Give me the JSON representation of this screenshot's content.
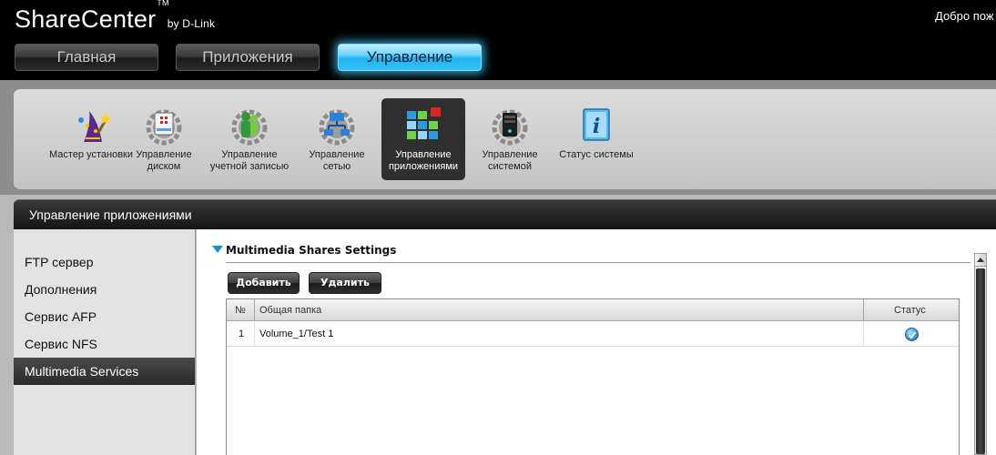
{
  "header": {
    "brand": "ShareCenter",
    "brand_tm": "TM",
    "brand_by": "by D-Link",
    "welcome": "Добро пож",
    "nav": [
      {
        "label": "Главная",
        "active": false
      },
      {
        "label": "Приложения",
        "active": false
      },
      {
        "label": "Управление",
        "active": true
      }
    ]
  },
  "toolbar": {
    "items": [
      {
        "label": "Мастер установки",
        "icon": "wizard-icon",
        "active": false
      },
      {
        "label": "Управление диском",
        "icon": "disk-icon",
        "active": false
      },
      {
        "label": "Управление учетной записью",
        "icon": "account-icon",
        "active": false
      },
      {
        "label": "Управление сетью",
        "icon": "network-icon",
        "active": false
      },
      {
        "label": "Управление приложениями",
        "icon": "applications-icon",
        "active": true
      },
      {
        "label": "Управление системой",
        "icon": "system-icon",
        "active": false
      },
      {
        "label": "Статус системы",
        "icon": "info-icon",
        "active": false
      }
    ]
  },
  "section": {
    "title": "Управление приложениями"
  },
  "sidebar": {
    "items": [
      {
        "label": "FTP сервер",
        "active": false
      },
      {
        "label": "Дополнения",
        "active": false
      },
      {
        "label": "Сервис AFP",
        "active": false
      },
      {
        "label": "Сервис NFS",
        "active": false
      },
      {
        "label": "Multimedia Services",
        "active": true
      }
    ]
  },
  "main": {
    "title": "Multimedia Shares Settings",
    "add_label": "Добавить",
    "delete_label": "Удалить",
    "table": {
      "columns": [
        "№",
        "Общая папка",
        "Статус"
      ],
      "rows": [
        {
          "num": "1",
          "folder": "Volume_1/Test 1",
          "status": "enabled"
        }
      ]
    }
  },
  "colors": {
    "accent": "#33c2f7",
    "status": "#3a9de0"
  }
}
